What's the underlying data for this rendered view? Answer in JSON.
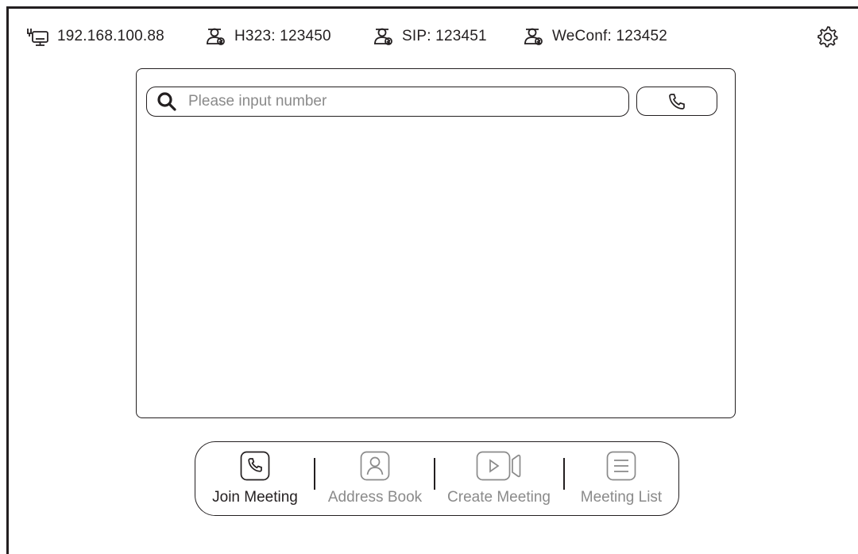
{
  "status_bar": {
    "ip": "192.168.100.88",
    "h323": "H323: 123450",
    "sip": "SIP: 123451",
    "weconf": "WeConf: 123452"
  },
  "dial": {
    "placeholder": "Please input number",
    "value": ""
  },
  "nav": {
    "join_meeting": "Join Meeting",
    "address_book": "Address Book",
    "create_meeting": "Create Meeting",
    "meeting_list": "Meeting List",
    "active": "join_meeting"
  },
  "icons": {
    "network": "network-icon",
    "account": "account-registered-icon",
    "settings": "gear-icon",
    "search": "search-icon",
    "call": "phone-icon"
  },
  "colors": {
    "ink": "#231f20",
    "muted": "#8a8a8a",
    "background": "#ffffff"
  }
}
